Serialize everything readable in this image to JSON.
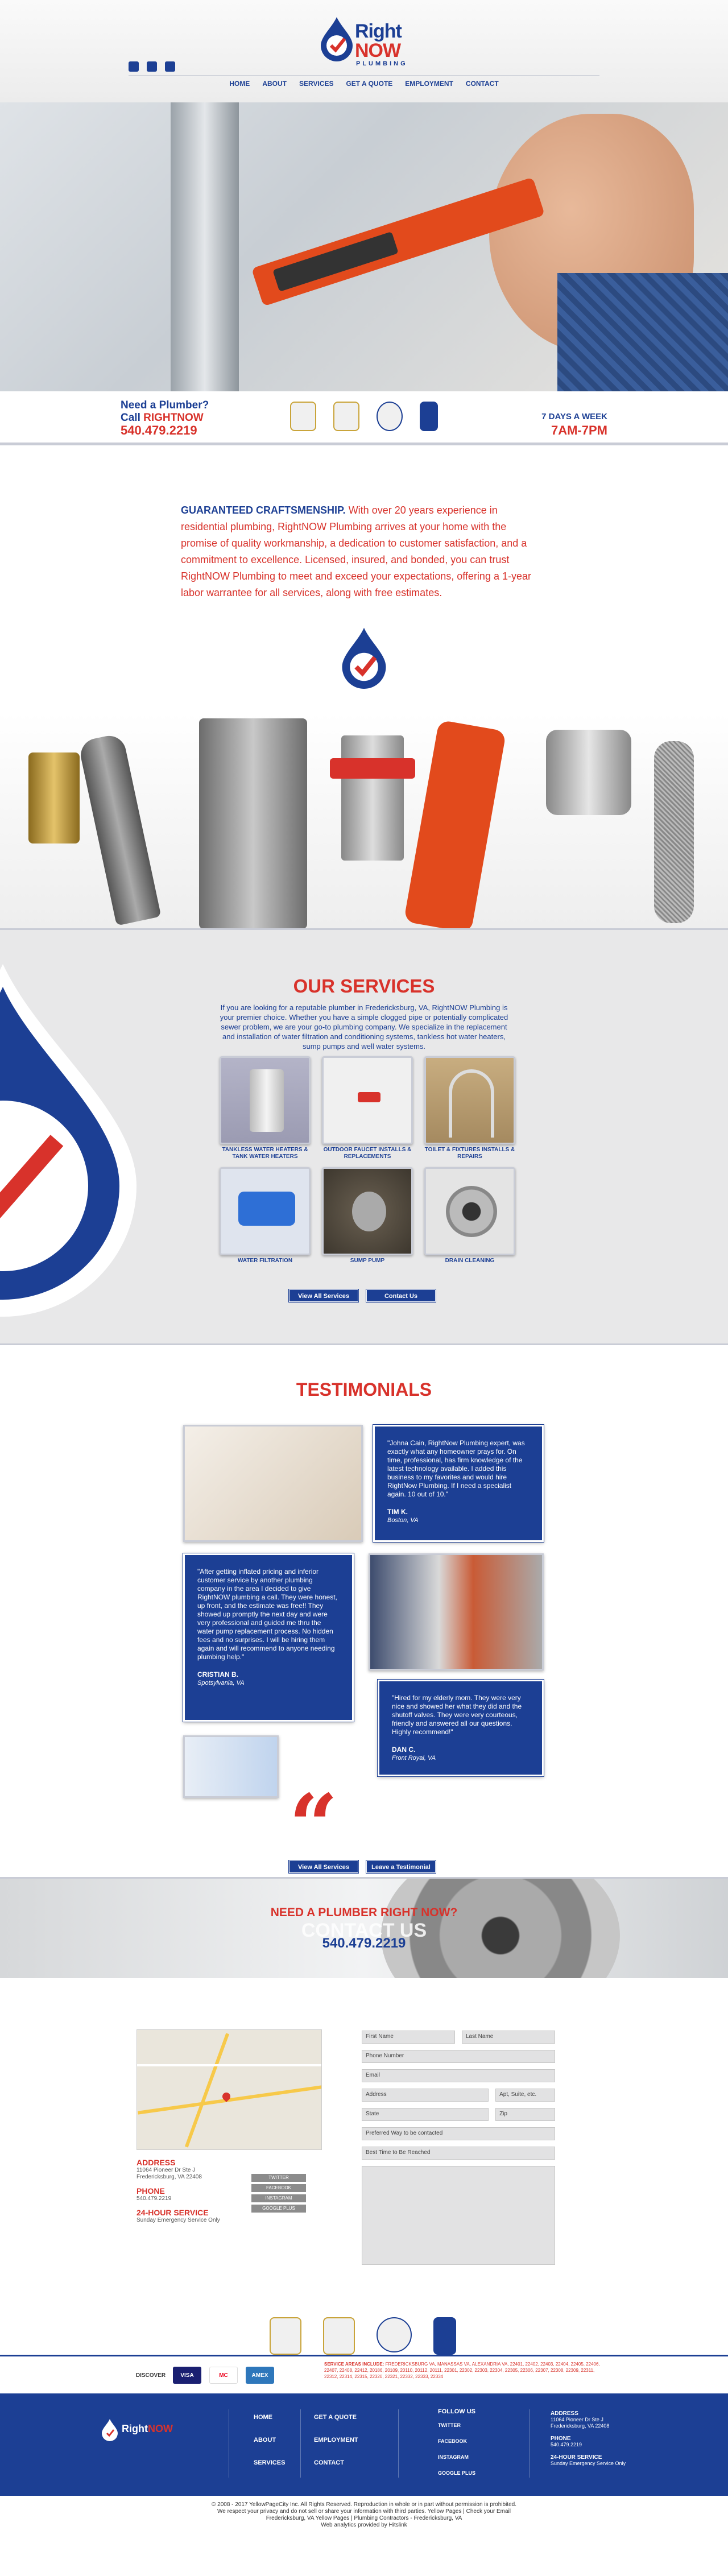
{
  "brand": {
    "line1": "Right",
    "line2": "NOW",
    "line3": "PLUMBING"
  },
  "nav": {
    "items": [
      "HOME",
      "ABOUT",
      "SERVICES",
      "GET A QUOTE",
      "EMPLOYMENT",
      "CONTACT"
    ]
  },
  "strip": {
    "need": "Need a Plumber?",
    "call_prefix": "Call ",
    "call_brand": "RIGHTNOW",
    "phone": "540.479.2219",
    "days": "7 DAYS A WEEK",
    "hours": "7AM-7PM"
  },
  "craft": {
    "lead": "GUARANTEED CRAFTSMENSHIP.",
    "body": " With over 20 years experience in residential plumbing, RightNOW Plumbing arrives at your home with the promise of quality workmanship, a dedication to customer satisfaction, and a commitment to excellence. Licensed, insured, and bonded, you can trust RightNOW Plumbing to meet and exceed your expectations, offering a 1-year labor warrantee for all services, along with free estimates."
  },
  "services": {
    "title": "OUR SERVICES",
    "intro": "If you are looking for a reputable plumber in Fredericksburg, VA, RightNOW Plumbing is your premier choice. Whether you have a simple clogged pipe or potentially complicated sewer problem, we are your go-to plumbing company. We specialize in the replacement and installation of water filtration and conditioning systems, tankless hot water heaters, sump pumps and well water systems.",
    "items": [
      "TANKLESS WATER HEATERS & TANK WATER HEATERS",
      "OUTDOOR FAUCET INSTALLS & REPLACEMENTS",
      "TOILET & FIXTURES INSTALLS & REPAIRS",
      "WATER FILTRATION",
      "SUMP PUMP",
      "DRAIN CLEANING"
    ],
    "btn_all": "View All Services",
    "btn_contact": "Contact Us"
  },
  "testimonials": {
    "title": "TESTIMONIALS",
    "t1": {
      "text": "\"Johna Cain, RightNow Plumbing expert, was exactly what any homeowner prays for. On time, professional, has firm knowledge of the latest technology available. I added this business to my favorites and would hire RightNow Plumbing. If I need a specialist again. 10 out of 10.\"",
      "who": "TIM K.",
      "loc": "Boston, VA"
    },
    "t2": {
      "text": "\"After getting inflated pricing and inferior customer service by another plumbing company in the area I decided to give RightNOW plumbing a call. They were honest, up front, and the estimate was free!! They showed up promptly the next day and were very professional and guided me thru the water pump replacement process. No hidden fees and no surprises. I will be hiring them again and will recommend to anyone needing plumbing help.\"",
      "who": "CRISTIAN B.",
      "loc": "Spotsylvania, VA"
    },
    "t3": {
      "text": "\"Hired for my elderly mom. They were very nice and showed her what they did and the shutoff valves. They were very courteous, friendly and answered all our questions. Highly recommend!\"",
      "who": "DAN C.",
      "loc": "Front Royal, VA"
    },
    "btn_all": "View All Services",
    "btn_leave": "Leave a Testimonial"
  },
  "banner": {
    "ask": "NEED A PLUMBER RIGHT NOW?",
    "contact": "CONTACT US",
    "phone": "540.479.2219"
  },
  "contact": {
    "address_h": "ADDRESS",
    "address": "11064 Pioneer Dr Ste J",
    "city": "Fredericksburg, VA 22408",
    "phone_h": "PHONE",
    "phone": "540.479.2219",
    "service_h": "24-HOUR SERVICE",
    "service": "Sunday Emergency Service Only",
    "social": [
      "Twitter",
      "Facebook",
      "Instagram",
      "Google Plus"
    ],
    "form": {
      "first": "First Name",
      "last": "Last Name",
      "phone": "Phone Number",
      "email": "Email",
      "address": "Address",
      "apt": "Apt, Suite, etc.",
      "state": "State",
      "zip": "Zip",
      "preferred": "Preferred Way to be contacted",
      "besttime": "Best Time to Be Reached"
    }
  },
  "payments": {
    "cards": [
      "DISCOVER",
      "VISA",
      "MC",
      "AMEX"
    ]
  },
  "areas": {
    "label": "SERVICE AREAS INCLUDE:",
    "text": " FREDERICKSBURG VA, MANASSAS VA, ALEXANDRIA VA, 22401, 22402, 22403, 22404, 22405, 22406, 22407, 22408, 22412, 20186, 20109, 20110, 20112, 20111, 22301, 22302, 22303, 22304, 22305, 22306, 22307, 22308, 22309, 22311, 22312, 22314, 22315, 22320, 22321, 22332, 22333, 22334"
  },
  "footer": {
    "col1": [
      "HOME",
      "ABOUT",
      "SERVICES"
    ],
    "col2": [
      "GET A QUOTE",
      "EMPLOYMENT",
      "CONTACT"
    ],
    "follow": "FOLLOW US",
    "social": [
      "TWITTER",
      "FACEBOOK",
      "INSTAGRAM",
      "GOOGLE PLUS"
    ],
    "addr_h": "ADDRESS",
    "addr1": "11064 Pioneer Dr Ste J",
    "addr2": "Fredericksburg, VA 22408",
    "phone_h": "PHONE",
    "phone": "540.479.2219",
    "svc_h": "24-HOUR SERVICE",
    "svc": "Sunday Emergency Service Only",
    "legal1": "© 2008 - 2017 YellowPageCity Inc. All Rights Reserved. Reproduction in whole or in part without permission is prohibited.",
    "legal2": "We respect your privacy and do not sell or share your information with third parties. Yellow Pages | Check your Email",
    "legal3": "Fredericksburg, VA Yellow Pages | Plumbing Contractors - Fredericksburg, VA",
    "legal4": "Web analytics provided by Hitslink"
  },
  "colors": {
    "brand_blue": "#1c3f94",
    "brand_red": "#d8322b"
  }
}
